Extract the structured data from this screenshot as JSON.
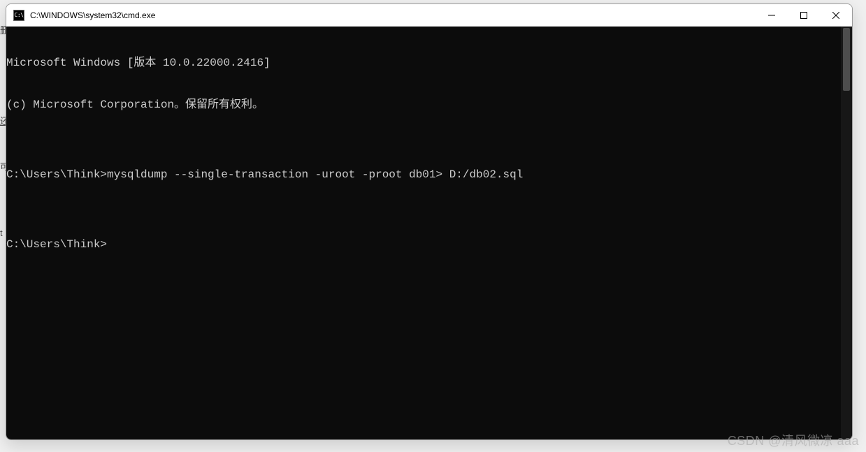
{
  "behind": {
    "t1": "删",
    "t2": "还",
    "t3": "可",
    "t4": "t"
  },
  "titlebar": {
    "icon_label": "C:\\",
    "title": "C:\\WINDOWS\\system32\\cmd.exe"
  },
  "terminal": {
    "lines": [
      "Microsoft Windows [版本 10.0.22000.2416]",
      "(c) Microsoft Corporation。保留所有权利。",
      "",
      "C:\\Users\\Think>mysqldump --single-transaction -uroot -proot db01> D:/db02.sql",
      "",
      "C:\\Users\\Think>"
    ]
  },
  "watermark": "CSDN @清风微凉 aaa"
}
